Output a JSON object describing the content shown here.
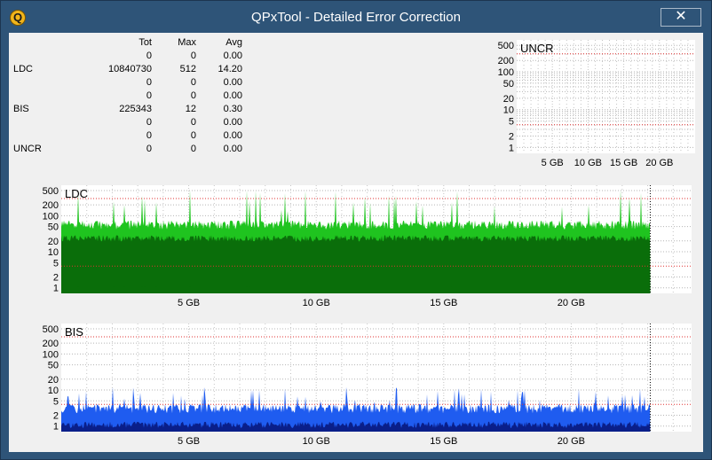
{
  "window": {
    "title": "QPxTool - Detailed Error Correction",
    "close_glyph": "✕",
    "app_icon_letter": "Q"
  },
  "stats": {
    "headers": [
      "",
      "Tot",
      "Max",
      "Avg"
    ],
    "rows": [
      [
        "",
        "0",
        "0",
        "0.00"
      ],
      [
        "LDC",
        "10840730",
        "512",
        "14.20"
      ],
      [
        "",
        "0",
        "0",
        "0.00"
      ],
      [
        "",
        "0",
        "0",
        "0.00"
      ],
      [
        "BIS",
        "225343",
        "12",
        "0.30"
      ],
      [
        "",
        "0",
        "0",
        "0.00"
      ],
      [
        "",
        "0",
        "0",
        "0.00"
      ],
      [
        "UNCR",
        "0",
        "0",
        "0.00"
      ]
    ]
  },
  "chart_data": [
    {
      "type": "bar",
      "title": "UNCR",
      "y_scale": "log",
      "yticks": [
        "500",
        "200",
        "100",
        "50",
        "20",
        "10",
        "5",
        "2",
        "1"
      ],
      "xticks": [
        "5 GB",
        "10 GB",
        "15 GB",
        "20 GB"
      ],
      "xlim_gb": [
        0,
        25
      ],
      "threshold_lines": [
        300,
        4
      ],
      "values": [],
      "color": "#00aa00"
    },
    {
      "type": "bar",
      "title": "LDC",
      "y_scale": "log",
      "yticks": [
        "500",
        "200",
        "100",
        "50",
        "20",
        "10",
        "5",
        "2",
        "1"
      ],
      "xticks": [
        "5 GB",
        "10 GB",
        "15 GB",
        "20 GB"
      ],
      "xlim_gb": [
        0,
        25
      ],
      "data_end_gb": 23.1,
      "threshold_lines": [
        300,
        4
      ],
      "typical_max": 50,
      "typical_mean": 25,
      "peak": 512,
      "colors": {
        "max": "#1fc41f",
        "mean": "#0a6e0a"
      }
    },
    {
      "type": "bar",
      "title": "BIS",
      "y_scale": "log",
      "yticks": [
        "500",
        "200",
        "100",
        "50",
        "20",
        "10",
        "5",
        "2",
        "1"
      ],
      "xticks": [
        "5 GB",
        "10 GB",
        "15 GB",
        "20 GB"
      ],
      "xlim_gb": [
        0,
        25
      ],
      "data_end_gb": 23.1,
      "threshold_lines": [
        300,
        4
      ],
      "typical_max": 3,
      "peak": 12,
      "colors": {
        "max": "#1f5cf0",
        "mean": "#0a1f8a"
      }
    }
  ]
}
